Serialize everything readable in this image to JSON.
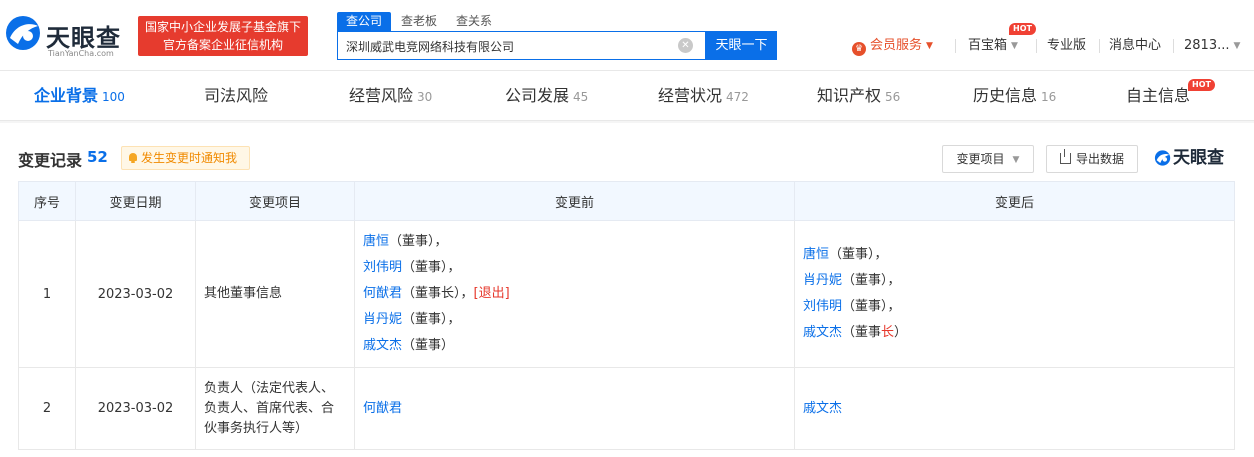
{
  "header": {
    "logo_name": "天眼查",
    "logo_domain": "TianYanCha.com",
    "fund_line1": "国家中小企业发展子基金旗下",
    "fund_line2": "官方备案企业征信机构",
    "search_tabs": [
      "查公司",
      "查老板",
      "查关系"
    ],
    "search_value": "深圳威武电竞网络科技有限公司",
    "search_button": "天眼一下",
    "nav": {
      "member": "会员服务",
      "treasure": "百宝箱",
      "treasure_badge": "HOT",
      "pro": "专业版",
      "messages": "消息中心",
      "user": "2813..."
    }
  },
  "tabs": [
    {
      "label": "企业背景",
      "count": "100"
    },
    {
      "label": "司法风险",
      "count": ""
    },
    {
      "label": "经营风险",
      "count": "30"
    },
    {
      "label": "公司发展",
      "count": "45"
    },
    {
      "label": "经营状况",
      "count": "472"
    },
    {
      "label": "知识产权",
      "count": "56"
    },
    {
      "label": "历史信息",
      "count": "16"
    },
    {
      "label": "自主信息",
      "count": ""
    }
  ],
  "tab_hot_badge": "HOT",
  "section": {
    "title": "变更记录",
    "count": "52",
    "notify_label": "发生变更时通知我",
    "filter_label": "变更项目",
    "export_label": "导出数据",
    "watermark": "天眼查"
  },
  "table": {
    "headers": [
      "序号",
      "变更日期",
      "变更项目",
      "变更前",
      "变更后"
    ],
    "rows": [
      {
        "idx": "1",
        "date": "2023-03-02",
        "item": "其他董事信息",
        "before": [
          {
            "name": "唐恒",
            "role": "（董事）",
            "suffix": "，"
          },
          {
            "name": "刘伟明",
            "role": "（董事）",
            "suffix": "，"
          },
          {
            "name": "何猷君",
            "role": "（董事长）",
            "suffix": "，",
            "tag": "[退出]"
          },
          {
            "name": "肖丹妮",
            "role": "（董事）",
            "suffix": "，"
          },
          {
            "name": "戚文杰",
            "role": "（董事）",
            "suffix": ""
          }
        ],
        "after": [
          {
            "name": "唐恒",
            "role": "（董事）",
            "suffix": "，"
          },
          {
            "name": "肖丹妮",
            "role": "（董事）",
            "suffix": "，"
          },
          {
            "name": "刘伟明",
            "role": "（董事）",
            "suffix": "，"
          },
          {
            "name": "戚文杰",
            "role_pre": "（董事",
            "role_red": "长",
            "role_post": "）",
            "suffix": ""
          }
        ]
      },
      {
        "idx": "2",
        "date": "2023-03-02",
        "item": "负责人（法定代表人、负责人、首席代表、合伙事务执行人等）",
        "before_name": "何猷君",
        "after_name": "戚文杰"
      }
    ]
  },
  "colors": {
    "brand_blue": "#0a6fe8",
    "red": "#e6372b",
    "member_orange": "#e6502b",
    "header_bg": "#f2f8ff"
  }
}
